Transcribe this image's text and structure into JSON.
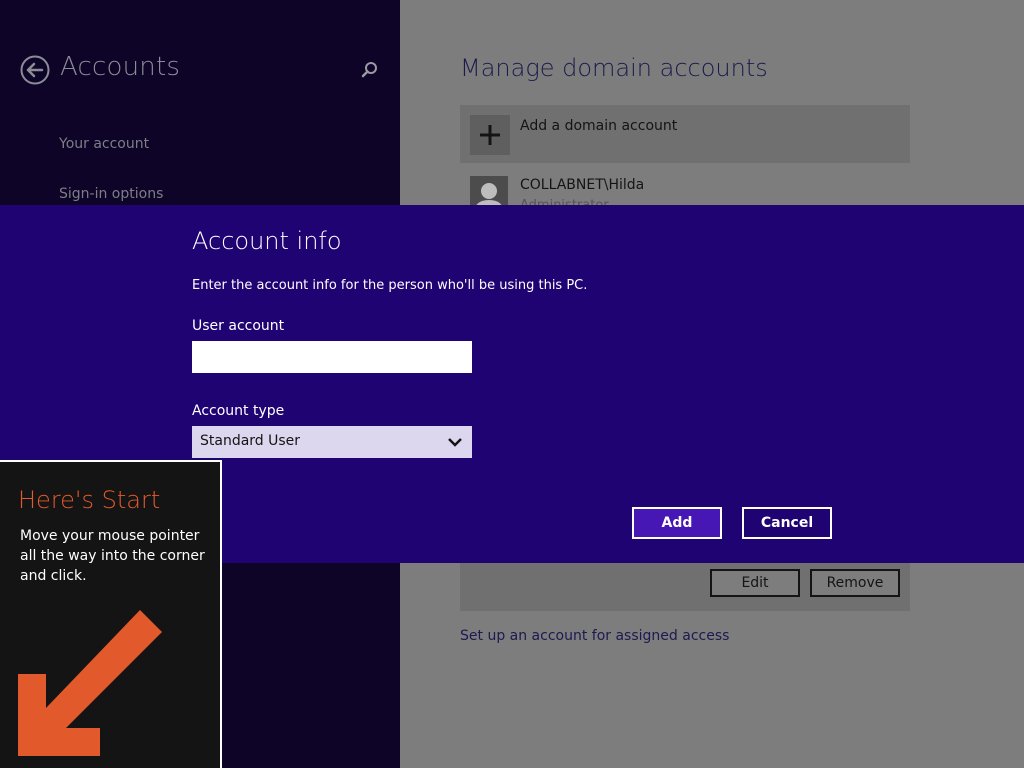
{
  "left_pane": {
    "title": "Accounts",
    "back_icon": "back-arrow-icon",
    "search_icon": "search-icon",
    "nav": [
      {
        "label": "Your account"
      },
      {
        "label": "Sign-in options"
      }
    ]
  },
  "right_pane": {
    "title": "Manage domain accounts",
    "add_account_label": "Add a domain account",
    "account": {
      "name": "COLLABNET\\Hilda",
      "role": "Administrator"
    },
    "edit_label": "Edit",
    "remove_label": "Remove",
    "assigned_access_link": "Set up an account for assigned access"
  },
  "dialog": {
    "title": "Account info",
    "description": "Enter the account info for the person who'll be using this PC.",
    "user_account_label": "User account",
    "user_account_value": "",
    "account_type_label": "Account type",
    "account_type_value": "Standard User",
    "add_label": "Add",
    "cancel_label": "Cancel"
  },
  "start_tip": {
    "title": "Here's Start",
    "body": "Move your mouse pointer all the way into the corner and click.",
    "arrow_icon": "arrow-down-left-icon"
  },
  "colors": {
    "left_pane_bg": "#0d0428",
    "dialog_bg": "#1f0373",
    "add_button_bg": "#4617b4",
    "tip_title": "#e35b2c",
    "tip_arrow": "#e25a2c"
  }
}
